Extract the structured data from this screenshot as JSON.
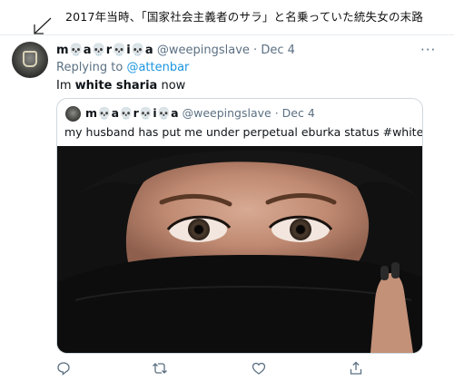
{
  "caption": "2017年当時、「国家社会主義者のサラ」と名乗っていた統失女の末路",
  "tweet": {
    "display_name": "m💀a💀r💀i💀a",
    "handle": "@weepingslave",
    "separator": "·",
    "date": "Dec 4",
    "more": "···",
    "reply_prefix": "Replying to ",
    "reply_to": "@attenbar",
    "text_part1": "Im ",
    "text_bold": "white sharia",
    "text_part2": " now"
  },
  "quoted": {
    "display_name": "m💀a💀r💀i💀a",
    "handle": "@weepingslave",
    "separator": "·",
    "date": "Dec 4",
    "text": "my husband has put me under perpetual eburka status #whitesharia"
  },
  "colors": {
    "link": "#1b95e0",
    "muted": "#5b7083",
    "border": "#cfd9de"
  }
}
